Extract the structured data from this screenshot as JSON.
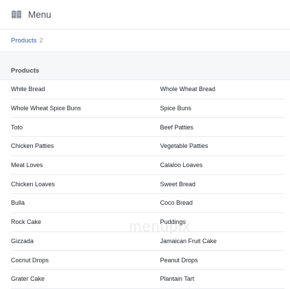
{
  "header": {
    "title": "Menu",
    "icon": "book-icon"
  },
  "tabs": [
    {
      "label": "Products",
      "count": "2"
    }
  ],
  "section": {
    "title": "Products"
  },
  "items": [
    [
      "White Bread",
      "Whole Wheat Bread"
    ],
    [
      "Whole Wheat Spice Buns",
      "Spice Buns"
    ],
    [
      "Toto",
      "Beef Patties"
    ],
    [
      "Chicken Patties",
      "Vegetable Patties"
    ],
    [
      "Meat Loves",
      "Calaloo Loaves"
    ],
    [
      "Chicken Loaves",
      "Sweet Bread"
    ],
    [
      "Bulla",
      "Coco Bread"
    ],
    [
      "Rock Cake",
      "Puddings"
    ],
    [
      "Gizzada",
      "Jamaican Fruit Cake"
    ],
    [
      "Cocnut Drops",
      "Peanut Drops"
    ],
    [
      "Grater Cake",
      "Plantain Tart"
    ]
  ],
  "watermark": "menupix"
}
